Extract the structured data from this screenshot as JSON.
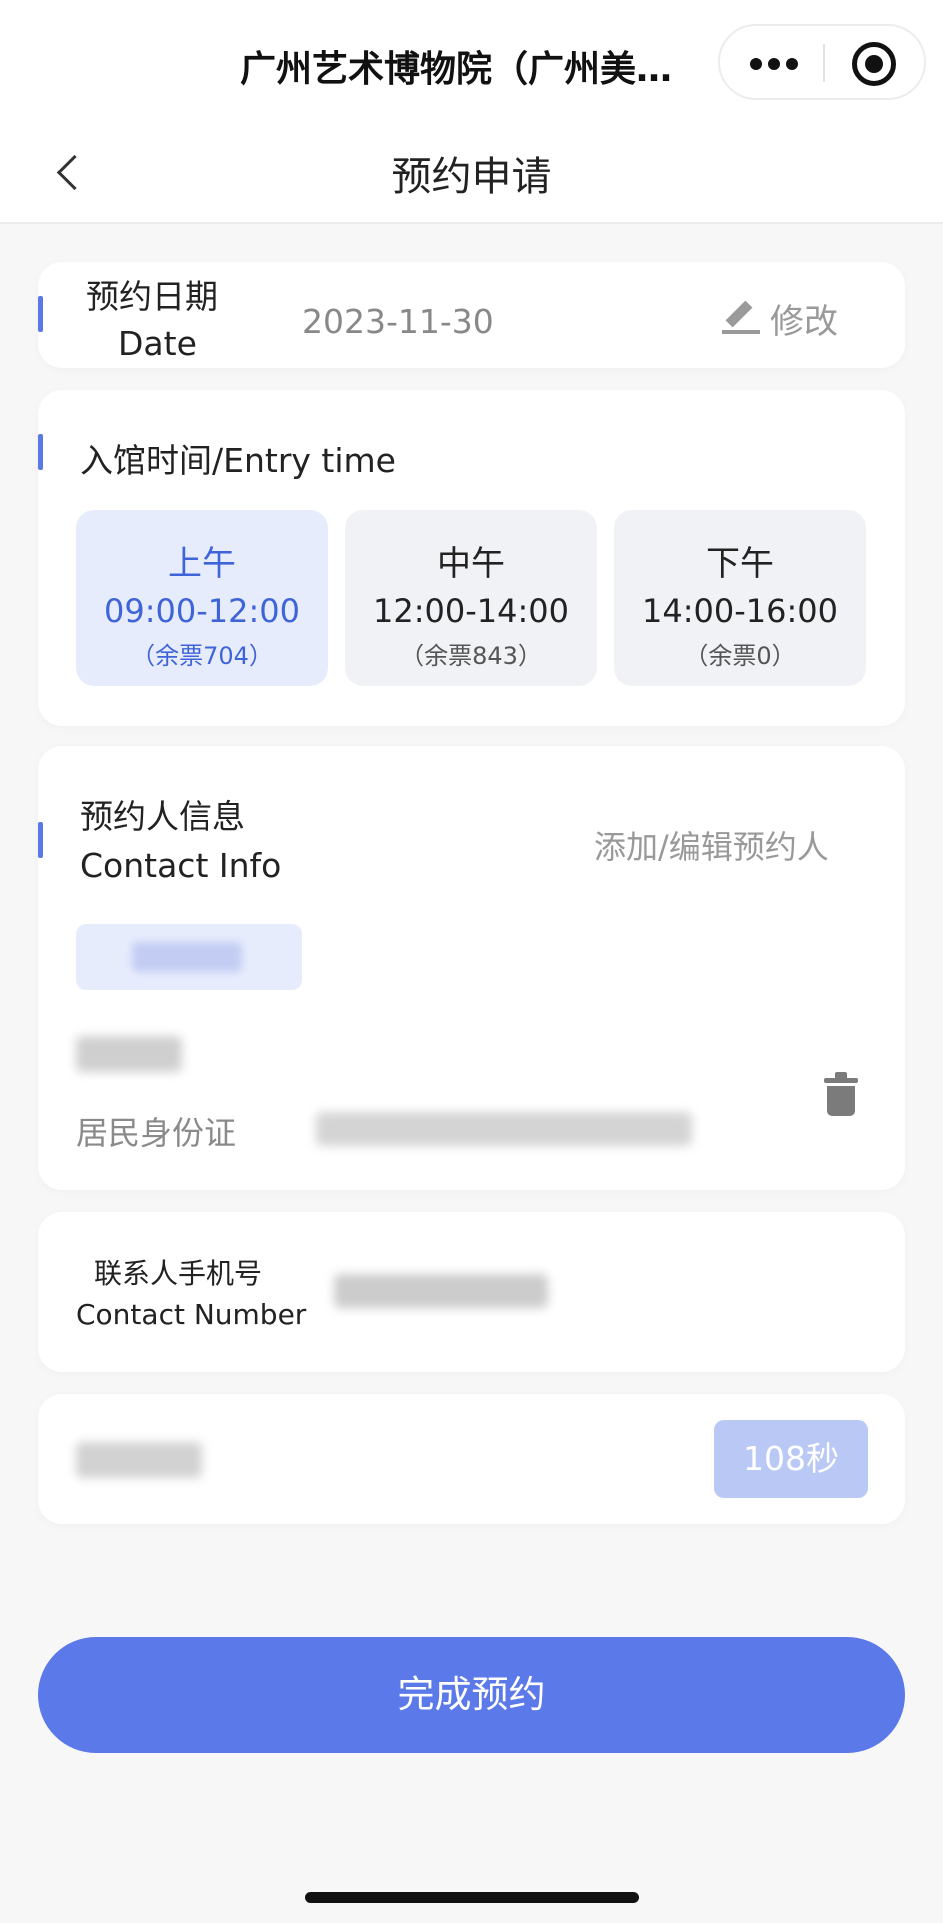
{
  "app": {
    "title": "广州艺术博物院（广州美…"
  },
  "nav": {
    "title": "预约申请"
  },
  "date_card": {
    "label_cn": "预约日期",
    "label_en": "Date",
    "value": "2023-11-30",
    "edit_label": "修改"
  },
  "entry_time": {
    "label": "入馆时间/Entry time",
    "slots": [
      {
        "period": "上午",
        "time": "09:00-12:00",
        "remaining": "（余票704）",
        "selected": true
      },
      {
        "period": "中午",
        "time": "12:00-14:00",
        "remaining": "（余票843）",
        "selected": false
      },
      {
        "period": "下午",
        "time": "14:00-16:00",
        "remaining": "（余票0）",
        "selected": false
      }
    ]
  },
  "contact_info": {
    "label_cn": "预约人信息",
    "label_en": "Contact Info",
    "edit_link": "添加/编辑预约人",
    "id_type": "居民身份证"
  },
  "phone": {
    "label_cn": "联系人手机号",
    "label_en": "Contact Number"
  },
  "verify": {
    "countdown": "108秒"
  },
  "submit_label": "完成预约",
  "colors": {
    "accent": "#5b79e8",
    "selected_bg": "#e7ecfd",
    "selected_text": "#3f64d8",
    "countdown_bg": "#b9c8f5"
  }
}
